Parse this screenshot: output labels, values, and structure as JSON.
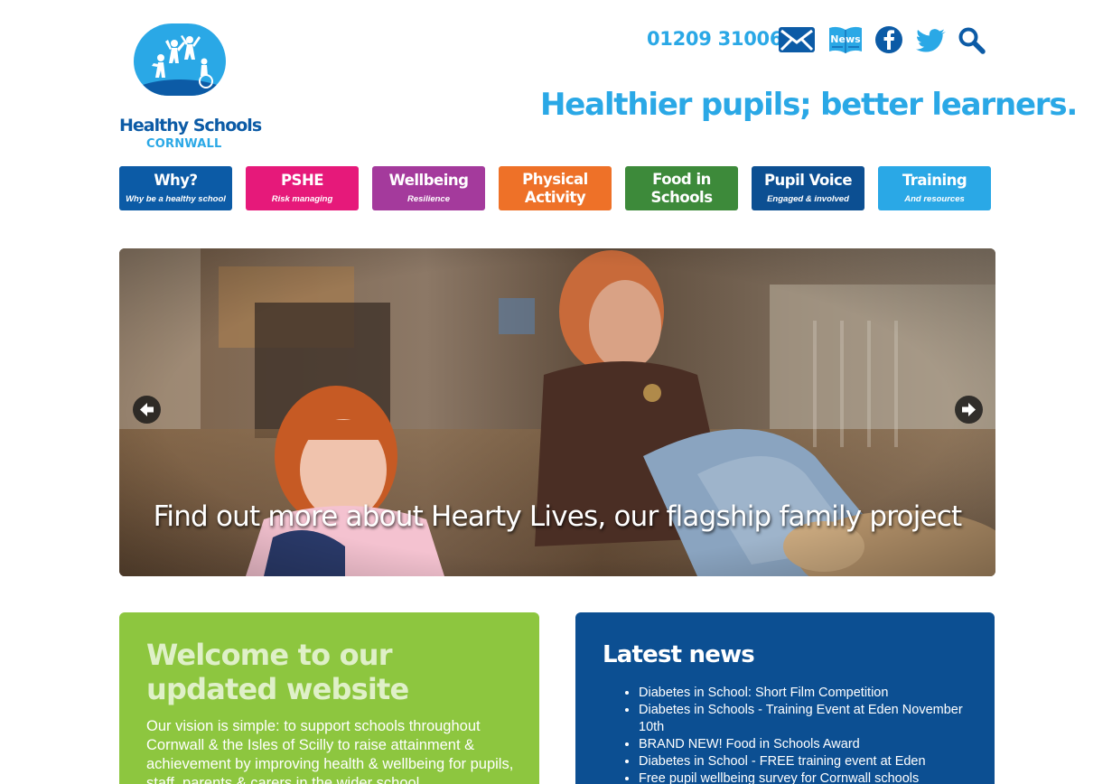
{
  "header": {
    "logo_title": "Healthy Schools",
    "logo_subtitle": "CORNWALL",
    "phone": "01209 310061",
    "news_icon_text": "News",
    "tagline": "Healthier pupils; better learners."
  },
  "icons": {
    "email": "envelope-icon",
    "news": "newspaper-icon",
    "facebook": "facebook-icon",
    "twitter": "twitter-bird-icon",
    "search": "magnifier-icon"
  },
  "nav": {
    "items": [
      {
        "label": "Why?",
        "sub": "Why be a healthy school",
        "color": "#0c5ba6"
      },
      {
        "label": "PSHE",
        "sub": "Risk managing",
        "color": "#e6197a"
      },
      {
        "label": "Wellbeing",
        "sub": "Resilience",
        "color": "#a43a9c"
      },
      {
        "label": "Physical Activity",
        "sub": "",
        "color": "#ee7128"
      },
      {
        "label": "Food in Schools",
        "sub": "",
        "color": "#3d8a3a"
      },
      {
        "label": "Pupil Voice",
        "sub": "Engaged & involved",
        "color": "#0c4f92"
      },
      {
        "label": "Training",
        "sub": "And resources",
        "color": "#2aa8e6"
      }
    ]
  },
  "hero": {
    "caption": "Find out more about Hearty Lives, our flagship family project"
  },
  "welcome": {
    "title": "Welcome to our updated website",
    "body": "Our vision is simple: to support schools throughout Cornwall & the Isles of Scilly to raise attainment & achievement by improving health & wellbeing for pupils, staff, parents & carers in the wider school"
  },
  "news": {
    "title": "Latest news",
    "items": [
      "Diabetes in School: Short Film Competition",
      "Diabetes in Schools - Training Event at Eden November 10th",
      "BRAND NEW! Food in Schools Award",
      "Diabetes in School - FREE training event at Eden",
      "Free pupil wellbeing survey for Cornwall schools"
    ]
  },
  "colors": {
    "brand_blue": "#2aa8e6",
    "dark_blue": "#0c5ba6",
    "welcome_green": "#8dc63f",
    "news_blue": "#0c4f92"
  }
}
